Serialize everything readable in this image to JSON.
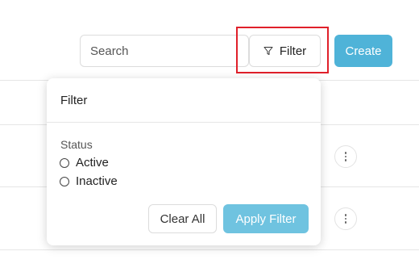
{
  "toolbar": {
    "search_placeholder": "Search",
    "filter_label": "Filter",
    "create_label": "Create"
  },
  "filter_popover": {
    "title": "Filter",
    "status_label": "Status",
    "options": [
      {
        "label": "Active",
        "selected": false
      },
      {
        "label": "Inactive",
        "selected": false
      }
    ],
    "clear_label": "Clear All",
    "apply_label": "Apply Filter"
  },
  "icons": {
    "filter": "funnel-icon",
    "row_menu": "more-vertical-icon"
  },
  "colors": {
    "primary": "#4fb3d8",
    "apply": "#6fc3e0",
    "highlight": "#e0202a"
  }
}
